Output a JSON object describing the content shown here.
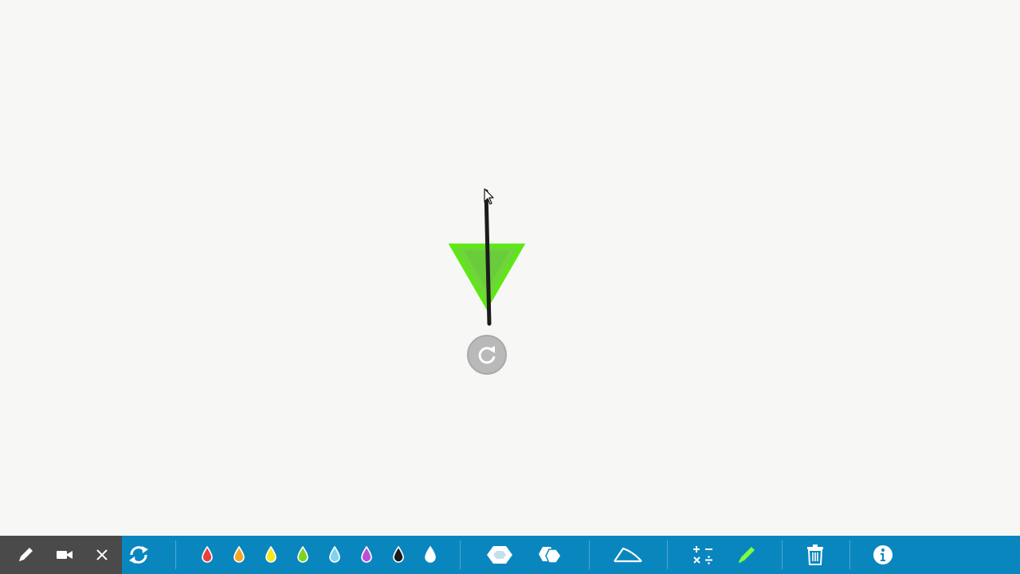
{
  "canvas": {
    "shape": {
      "type": "triangle-pointing-down",
      "fill_color": "#6ee62a",
      "stroke_color": "#52e008",
      "line_color": "#1c1c1c"
    },
    "rotate_handle_icon": "rotate-icon"
  },
  "toolbar": {
    "left_group": [
      {
        "name": "pen-tool",
        "icon": "pen-icon"
      },
      {
        "name": "video-tool",
        "icon": "video-camera-icon"
      },
      {
        "name": "close-tool",
        "icon": "close-icon"
      }
    ],
    "sync_icon": "sync-icon",
    "color_drops": [
      {
        "name": "red",
        "color": "#e8413c"
      },
      {
        "name": "orange",
        "color": "#f5a623"
      },
      {
        "name": "yellow",
        "color": "#f8e71c"
      },
      {
        "name": "green",
        "color": "#7ed321"
      },
      {
        "name": "cyan",
        "color": "#7fd3ee"
      },
      {
        "name": "purple",
        "color": "#bd4fd6"
      },
      {
        "name": "black",
        "color": "#1a1a1a"
      },
      {
        "name": "white",
        "color": "#ffffff"
      }
    ],
    "shape_tools": [
      {
        "name": "filled-shape",
        "icon": "filled-shape-icon"
      },
      {
        "name": "hexagon-shape",
        "icon": "hexagon-icon"
      }
    ],
    "angle_tool_icon": "angle-icon",
    "math_tool_icon": "math-operators-icon",
    "highlighter_icon": "highlighter-icon",
    "highlighter_color": "#7cff3a",
    "trash_icon": "trash-icon",
    "info_icon": "info-icon"
  }
}
